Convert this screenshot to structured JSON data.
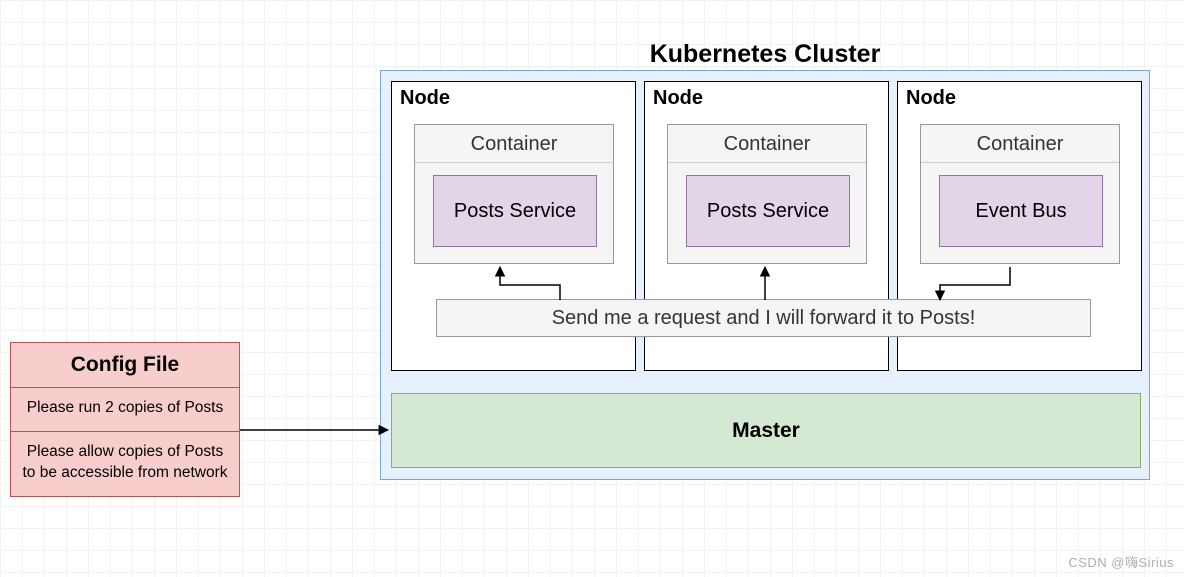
{
  "diagram": {
    "title": "Kubernetes Cluster",
    "nodes": [
      {
        "label": "Node",
        "container": "Container",
        "service": "Posts Service"
      },
      {
        "label": "Node",
        "container": "Container",
        "service": "Posts Service"
      },
      {
        "label": "Node",
        "container": "Container",
        "service": "Event Bus"
      }
    ],
    "forward_text": "Send me a request and I will forward it to Posts!",
    "master": "Master"
  },
  "config": {
    "title": "Config File",
    "row1": "Please run 2 copies of Posts",
    "row2": "Please allow copies of Posts to be accessible from network"
  },
  "colors": {
    "cluster_bg": "#e7f0fd",
    "cluster_border": "#7fa5d6",
    "node_bg": "#ffffff",
    "node_border": "#000000",
    "container_bg": "#f5f5f5",
    "container_border": "#999999",
    "service_bg": "#e1d5e7",
    "service_border": "#9673a6",
    "master_bg": "#d5e8d4",
    "master_border": "#82b366",
    "config_bg": "#f8cecc",
    "config_border": "#b85450"
  },
  "watermark": "CSDN @嗨Sirius"
}
